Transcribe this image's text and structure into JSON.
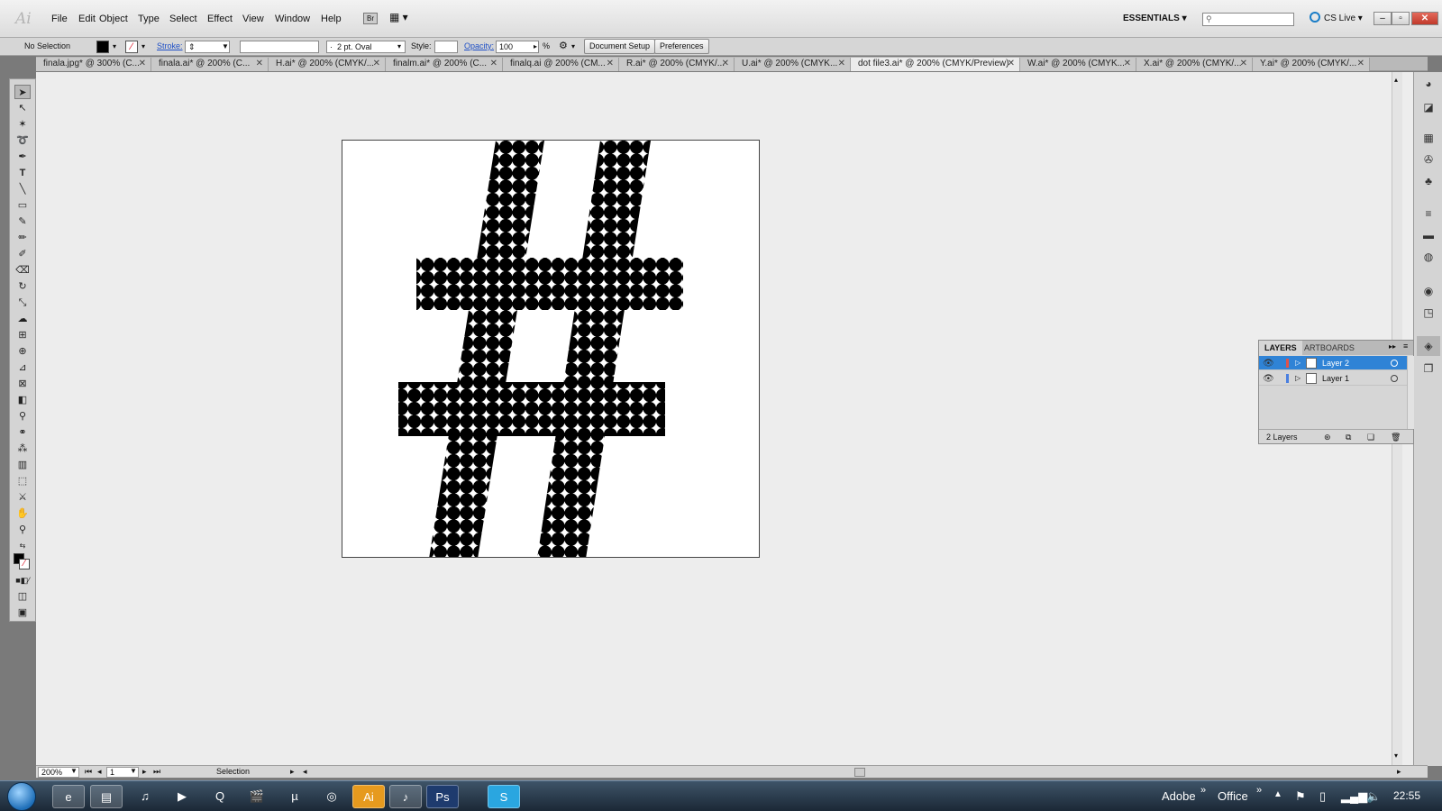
{
  "app": {
    "logo": "Ai",
    "menu": [
      "File",
      "Edit",
      "Object",
      "Type",
      "Select",
      "Effect",
      "View",
      "Window",
      "Help"
    ],
    "bridge_label": "Br",
    "workspace": "ESSENTIALS",
    "search_placeholder": "",
    "cslive": "CS Live"
  },
  "control_bar": {
    "selection": "No Selection",
    "stroke_label": "Stroke:",
    "brush": "2 pt. Oval",
    "brush_prefix": "·",
    "style_label": "Style:",
    "opacity_label": "Opacity:",
    "opacity_value": "100",
    "opacity_unit": "%",
    "document_setup": "Document Setup",
    "preferences": "Preferences"
  },
  "tabs": [
    {
      "label": "finala.jpg* @ 300% (C..."
    },
    {
      "label": "finala.ai* @ 200% (C..."
    },
    {
      "label": "H.ai* @ 200% (CMYK/..."
    },
    {
      "label": "finalm.ai* @ 200% (C..."
    },
    {
      "label": "finalq.ai @ 200% (CM..."
    },
    {
      "label": "R.ai* @ 200% (CMYK/..."
    },
    {
      "label": "U.ai* @ 200% (CMYK..."
    },
    {
      "label": "dot file3.ai* @ 200% (CMYK/Preview)"
    },
    {
      "label": "W.ai* @ 200% (CMYK..."
    },
    {
      "label": "X.ai* @ 200% (CMYK/..."
    },
    {
      "label": "Y.ai* @ 200% (CMYK/..."
    }
  ],
  "layers_panel": {
    "tab_layers": "LAYERS",
    "tab_artboards": "ARTBOARDS",
    "layers": [
      {
        "name": "Layer 2",
        "color": "#e0524a",
        "selected": true
      },
      {
        "name": "Layer 1",
        "color": "#4a7fe0",
        "selected": false
      }
    ],
    "count": "2 Layers"
  },
  "status_bar": {
    "zoom": "200%",
    "artboard": "1",
    "tool": "Selection"
  },
  "taskbar": {
    "tray_adobe": "Adobe",
    "tray_office": "Office",
    "clock": "22:55"
  },
  "colors": {
    "accent_blue": "#2f83d6",
    "canvas_bg": "#ededed",
    "artwork": "#000000"
  }
}
